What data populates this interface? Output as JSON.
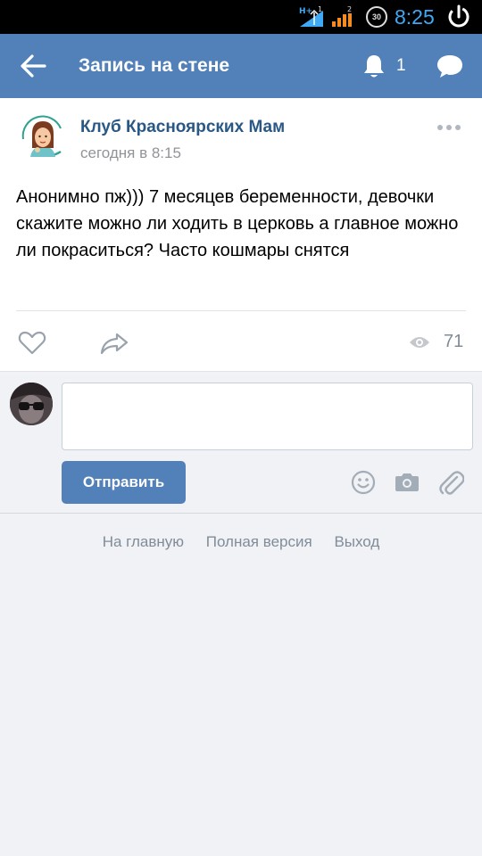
{
  "status_bar": {
    "network_label": "H+",
    "sim1": "1",
    "sim2": "2",
    "battery": "30",
    "time": "8:25"
  },
  "header": {
    "title": "Запись на стене",
    "notifications_count": "1",
    "accent_color": "#5181b8"
  },
  "post": {
    "author": "Клуб Красноярских Мам",
    "time": "сегодня в 8:15",
    "text": "Анонимно пж))) 7 месяцев беременности, девочки скажите можно ли ходить в церковь а главное можно ли покраситься? Часто кошмары снятся",
    "views": "71"
  },
  "comment": {
    "placeholder": "",
    "send_label": "Отправить"
  },
  "footer": {
    "links": [
      "На главную",
      "Полная версия",
      "Выход"
    ]
  },
  "icons": [
    "back-arrow-icon",
    "bell-icon",
    "chat-bubble-icon",
    "more-dots-icon",
    "heart-icon",
    "share-icon",
    "eye-icon",
    "smile-icon",
    "camera-icon",
    "paperclip-icon",
    "power-icon"
  ]
}
